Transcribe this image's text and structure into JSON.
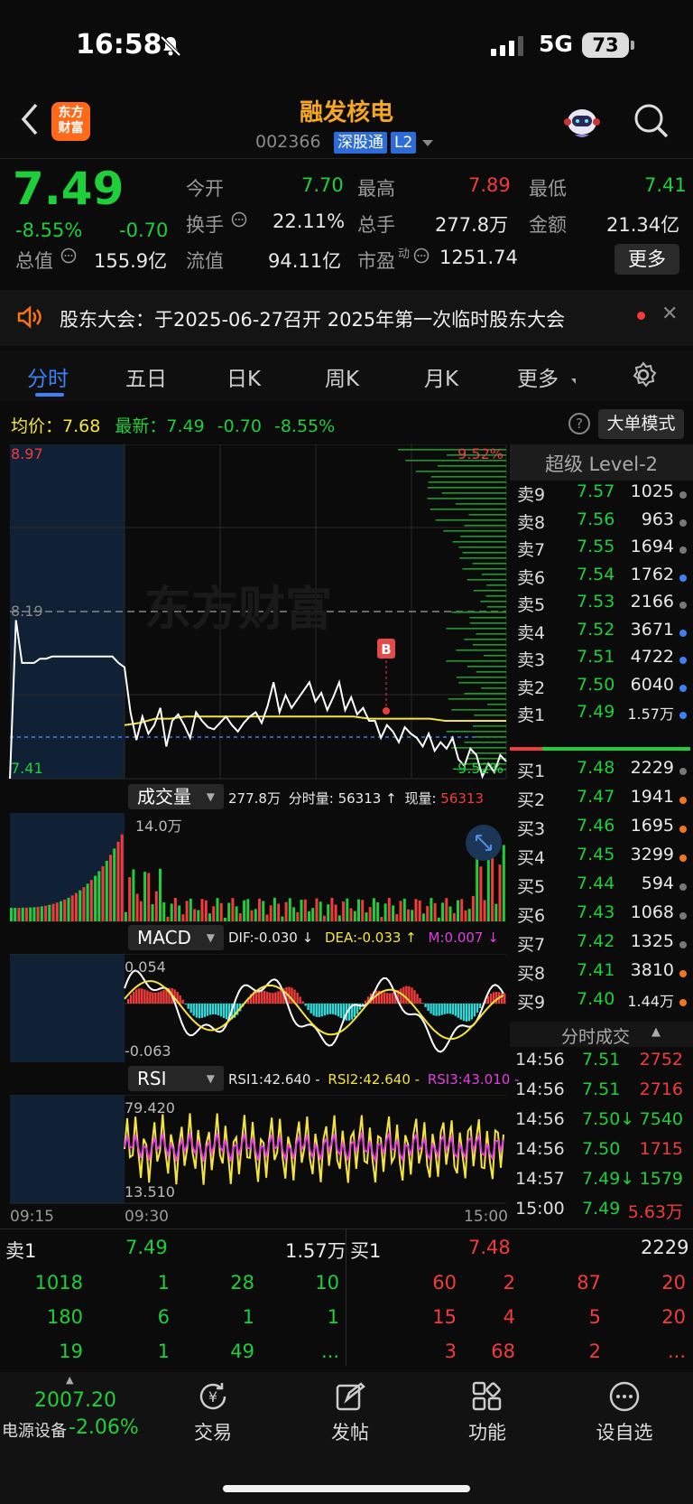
{
  "status": {
    "time": "16:58",
    "network": "5G",
    "battery": "73"
  },
  "header": {
    "logo_line1": "东方",
    "logo_line2": "财富",
    "title": "融发核电",
    "code": "002366",
    "tag1": "深股通",
    "tag2": "L2"
  },
  "quote": {
    "price": "7.49",
    "change_pct": "-8.55%",
    "change": "-0.70",
    "open_label": "今开",
    "open": "7.70",
    "high_label": "最高",
    "high": "7.89",
    "low_label": "最低",
    "low": "7.41",
    "turnover_label": "换手",
    "turnover": "22.11%",
    "volume_label": "总手",
    "volume": "277.8万",
    "amount_label": "金额",
    "amount": "21.34亿",
    "mktcap_label": "总值",
    "mktcap": "155.9亿",
    "float_label": "流值",
    "float": "94.11亿",
    "pe_label": "市盈",
    "pe_sup": "动",
    "pe": "1251.74",
    "more": "更多"
  },
  "notice": {
    "text": "股东大会：于2025-06-27召开 2025年第一次临时股东大会"
  },
  "tabs": [
    "分时",
    "五日",
    "日K",
    "周K",
    "月K",
    "更多"
  ],
  "infobar": {
    "avg_label": "均价：",
    "avg": "7.68",
    "last_label": "最新：",
    "last": "7.49",
    "chg": "-0.70",
    "pct": "-8.55%",
    "big_mode": "大单模式"
  },
  "chart_labels": {
    "top": "8.97",
    "mid": "8.19",
    "bottom": "7.41",
    "top_pct": "9.52%",
    "bottom_pct": "-9.52%",
    "b_marker": "B",
    "watermark": "东方财富"
  },
  "volume_panel": {
    "label": "成交量",
    "total": "277.8万",
    "min_label": "分时量:",
    "min_vol": "56313",
    "arrow": "↑",
    "now_label": "现量:",
    "now": "56313",
    "scale": "14.0万"
  },
  "macd_panel": {
    "label": "MACD",
    "dif": "DIF:-0.030 ↓",
    "dea": "DEA:-0.033 ↑",
    "m": "M:0.007 ↓",
    "top": "0.054",
    "bottom": "-0.063"
  },
  "rsi_panel": {
    "label": "RSI",
    "rsi1": "RSI1:42.640 -",
    "rsi2": "RSI2:42.640 -",
    "rsi3": "RSI3:43.010 -",
    "top": "79.420",
    "bottom": "13.510"
  },
  "time_axis": {
    "t1": "09:15",
    "t2": "09:30",
    "t3": "15:00"
  },
  "level2": {
    "title": "超级 Level-2",
    "asks": [
      {
        "n": "卖9",
        "p": "7.57",
        "v": "1025",
        "dot": "#777"
      },
      {
        "n": "卖8",
        "p": "7.56",
        "v": "963",
        "dot": "#777"
      },
      {
        "n": "卖7",
        "p": "7.55",
        "v": "1694",
        "dot": "#777"
      },
      {
        "n": "卖6",
        "p": "7.54",
        "v": "1762",
        "dot": "#3b82f6"
      },
      {
        "n": "卖5",
        "p": "7.53",
        "v": "2166",
        "dot": "#777"
      },
      {
        "n": "卖4",
        "p": "7.52",
        "v": "3671",
        "dot": "#3b82f6"
      },
      {
        "n": "卖3",
        "p": "7.51",
        "v": "4722",
        "dot": "#3b82f6"
      },
      {
        "n": "卖2",
        "p": "7.50",
        "v": "6040",
        "dot": "#3b82f6"
      },
      {
        "n": "卖1",
        "p": "7.49",
        "v": "1.57万",
        "dot": "#3b82f6"
      }
    ],
    "bids": [
      {
        "n": "买1",
        "p": "7.48",
        "v": "2229",
        "dot": "#777"
      },
      {
        "n": "买2",
        "p": "7.47",
        "v": "1941",
        "dot": "#f5731b"
      },
      {
        "n": "买3",
        "p": "7.46",
        "v": "1695",
        "dot": "#f5731b"
      },
      {
        "n": "买4",
        "p": "7.45",
        "v": "3299",
        "dot": "#f5731b"
      },
      {
        "n": "买5",
        "p": "7.44",
        "v": "594",
        "dot": "#777"
      },
      {
        "n": "买6",
        "p": "7.43",
        "v": "1068",
        "dot": "#777"
      },
      {
        "n": "买7",
        "p": "7.42",
        "v": "1325",
        "dot": "#777"
      },
      {
        "n": "买8",
        "p": "7.41",
        "v": "3810",
        "dot": "#f5731b"
      },
      {
        "n": "买9",
        "p": "7.40",
        "v": "1.44万",
        "dot": "#f5731b"
      }
    ]
  },
  "ticks": {
    "title": "分时成交",
    "rows": [
      {
        "t": "14:56",
        "p": "7.51",
        "v": "2752",
        "pc": "g",
        "vc": "r"
      },
      {
        "t": "14:56",
        "p": "7.51",
        "v": "2716",
        "pc": "g",
        "vc": "r"
      },
      {
        "t": "14:56",
        "p": "7.50↓",
        "v": "7540",
        "pc": "g",
        "vc": "g"
      },
      {
        "t": "14:56",
        "p": "7.50",
        "v": "1715",
        "pc": "g",
        "vc": "r"
      },
      {
        "t": "14:57",
        "p": "7.49↓",
        "v": "1579",
        "pc": "g",
        "vc": "g"
      },
      {
        "t": "15:00",
        "p": "7.49",
        "v": "5.63万",
        "pc": "g",
        "vc": "r"
      }
    ]
  },
  "queue": {
    "sell_label": "卖1",
    "sell_price": "7.49",
    "sell_total": "1.57万",
    "buy_label": "买1",
    "buy_price": "7.48",
    "buy_total": "2229",
    "sell_rows": [
      [
        "1018",
        "1",
        "28",
        "10"
      ],
      [
        "180",
        "6",
        "1",
        "1"
      ],
      [
        "19",
        "1",
        "49",
        "..."
      ]
    ],
    "buy_rows": [
      [
        "60",
        "2",
        "87",
        "20"
      ],
      [
        "15",
        "4",
        "5",
        "20"
      ],
      [
        "3",
        "68",
        "2",
        "..."
      ]
    ]
  },
  "nav": {
    "index_value": "2007.20",
    "index_name": "电源设备",
    "index_pct": "-2.06%",
    "items": [
      "交易",
      "发帖",
      "功能",
      "设自选"
    ]
  },
  "chart_data": {
    "type": "line",
    "price_range": [
      7.41,
      8.97
    ],
    "prev_close": 8.19,
    "price": [
      7.41,
      8.15,
      7.95,
      7.95,
      7.95,
      7.97,
      7.97,
      7.98,
      7.98,
      7.98,
      7.98,
      7.98,
      7.98,
      7.98,
      7.98,
      7.98,
      7.98,
      7.98,
      7.95,
      7.93,
      7.72,
      7.59,
      7.7,
      7.62,
      7.66,
      7.74,
      7.56,
      7.68,
      7.71,
      7.66,
      7.6,
      7.72,
      7.68,
      7.65,
      7.64,
      7.67,
      7.7,
      7.66,
      7.63,
      7.67,
      7.7,
      7.72,
      7.67,
      7.75,
      7.86,
      7.72,
      7.8,
      7.74,
      7.78,
      7.82,
      7.86,
      7.77,
      7.81,
      7.73,
      7.79,
      7.86,
      7.73,
      7.79,
      7.71,
      7.74,
      7.68,
      7.68,
      7.6,
      7.66,
      7.63,
      7.58,
      7.65,
      7.62,
      7.6,
      7.56,
      7.62,
      7.54,
      7.58,
      7.55,
      7.6,
      7.5,
      7.47,
      7.55,
      7.52,
      7.42,
      7.48,
      7.44,
      7.52,
      7.49
    ],
    "avg": [
      7.66,
      7.67,
      7.69,
      7.69,
      7.7,
      7.7,
      7.7,
      7.7,
      7.7,
      7.7,
      7.7,
      7.7,
      7.7,
      7.7,
      7.7,
      7.7,
      7.69,
      7.69,
      7.69,
      7.69,
      7.69,
      7.68,
      7.68,
      7.68,
      7.68,
      7.68
    ],
    "b_marker_price": 7.67,
    "level2_buy_bars_top_weighted": true
  }
}
